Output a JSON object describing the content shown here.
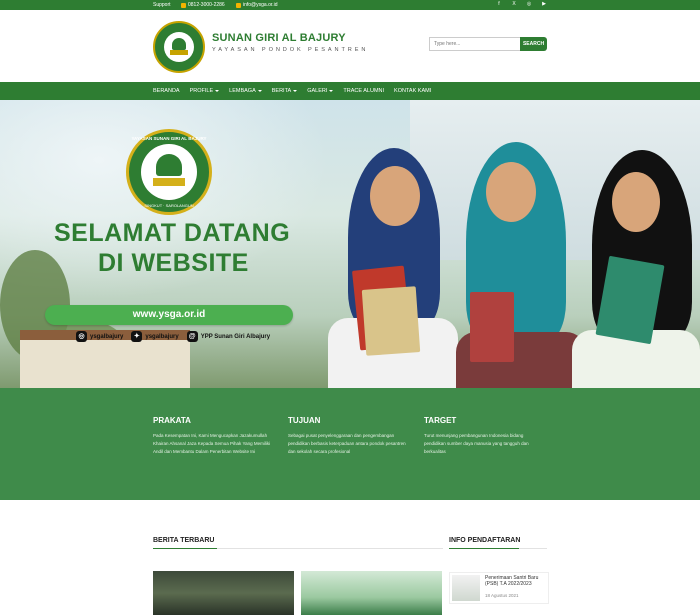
{
  "topbar": {
    "support": "Support",
    "phone": "0812-3000-2286",
    "email": "info@ysga.or.id",
    "socials": [
      "facebook-icon",
      "x-icon",
      "instagram-icon",
      "youtube-icon"
    ]
  },
  "header": {
    "title": "SUNAN GIRI AL BAJURY",
    "subtitle": "YAYASAN PONDOK PESANTREN",
    "search_placeholder": "Type here...",
    "search_button": "SEARCH"
  },
  "nav": {
    "items": [
      {
        "label": "BERANDA",
        "dropdown": false
      },
      {
        "label": "PROFILE",
        "dropdown": true
      },
      {
        "label": "LEMBAGA",
        "dropdown": true
      },
      {
        "label": "BERITA",
        "dropdown": true
      },
      {
        "label": "GALERI",
        "dropdown": true
      },
      {
        "label": "TRACE ALUMNI",
        "dropdown": false
      },
      {
        "label": "KONTAK KAMI",
        "dropdown": false
      }
    ]
  },
  "hero": {
    "logo_ring_top": "YAYASAN SUNAN GIRI AL BAJURY",
    "logo_ring_bottom": "SINGKUT · SAROLANGUN",
    "welcome_line1": "SELAMAT DATANG",
    "welcome_line2": "DI WEBSITE",
    "url": "www.ysga.or.id",
    "social": {
      "instagram": "ysgalbajury",
      "twitter": "ysgalbajury",
      "threads": "YPP Sunan Giri Albajury"
    }
  },
  "band": {
    "prakata_title": "PRAKATA",
    "prakata_text": "Pada Kesempatan Ini, Kami Mengucapkan Jazakumullah Khairan Ahsanal Jaza Kepada Semua Pihak Yang Memiliki Andil dan Membantu Dalam Penerbitan Website Ini",
    "tujuan_title": "TUJUAN",
    "tujuan_text": "Sebagai pusat penyelenggaraan dan pengembangan pendidikan berbasis keterpaduan antara pondok pesantren dan sekolah secara profesional",
    "target_title": "TARGET",
    "target_text": "Turut menunjang pembangunan Indonesia bidang pendidikan sumber daya manusia yang tangguh dan berkualitas"
  },
  "news": {
    "title": "BERITA TERBARU"
  },
  "info": {
    "title": "INFO PENDAFTARAN",
    "item_text": "Penerimaan Santri Baru (PSB) T.A 2022/2023",
    "item_date": "18 Agustus 2021"
  },
  "colors": {
    "brand_green": "#2e7d32",
    "band_green": "#3f8b4a",
    "gold": "#c6a300"
  }
}
